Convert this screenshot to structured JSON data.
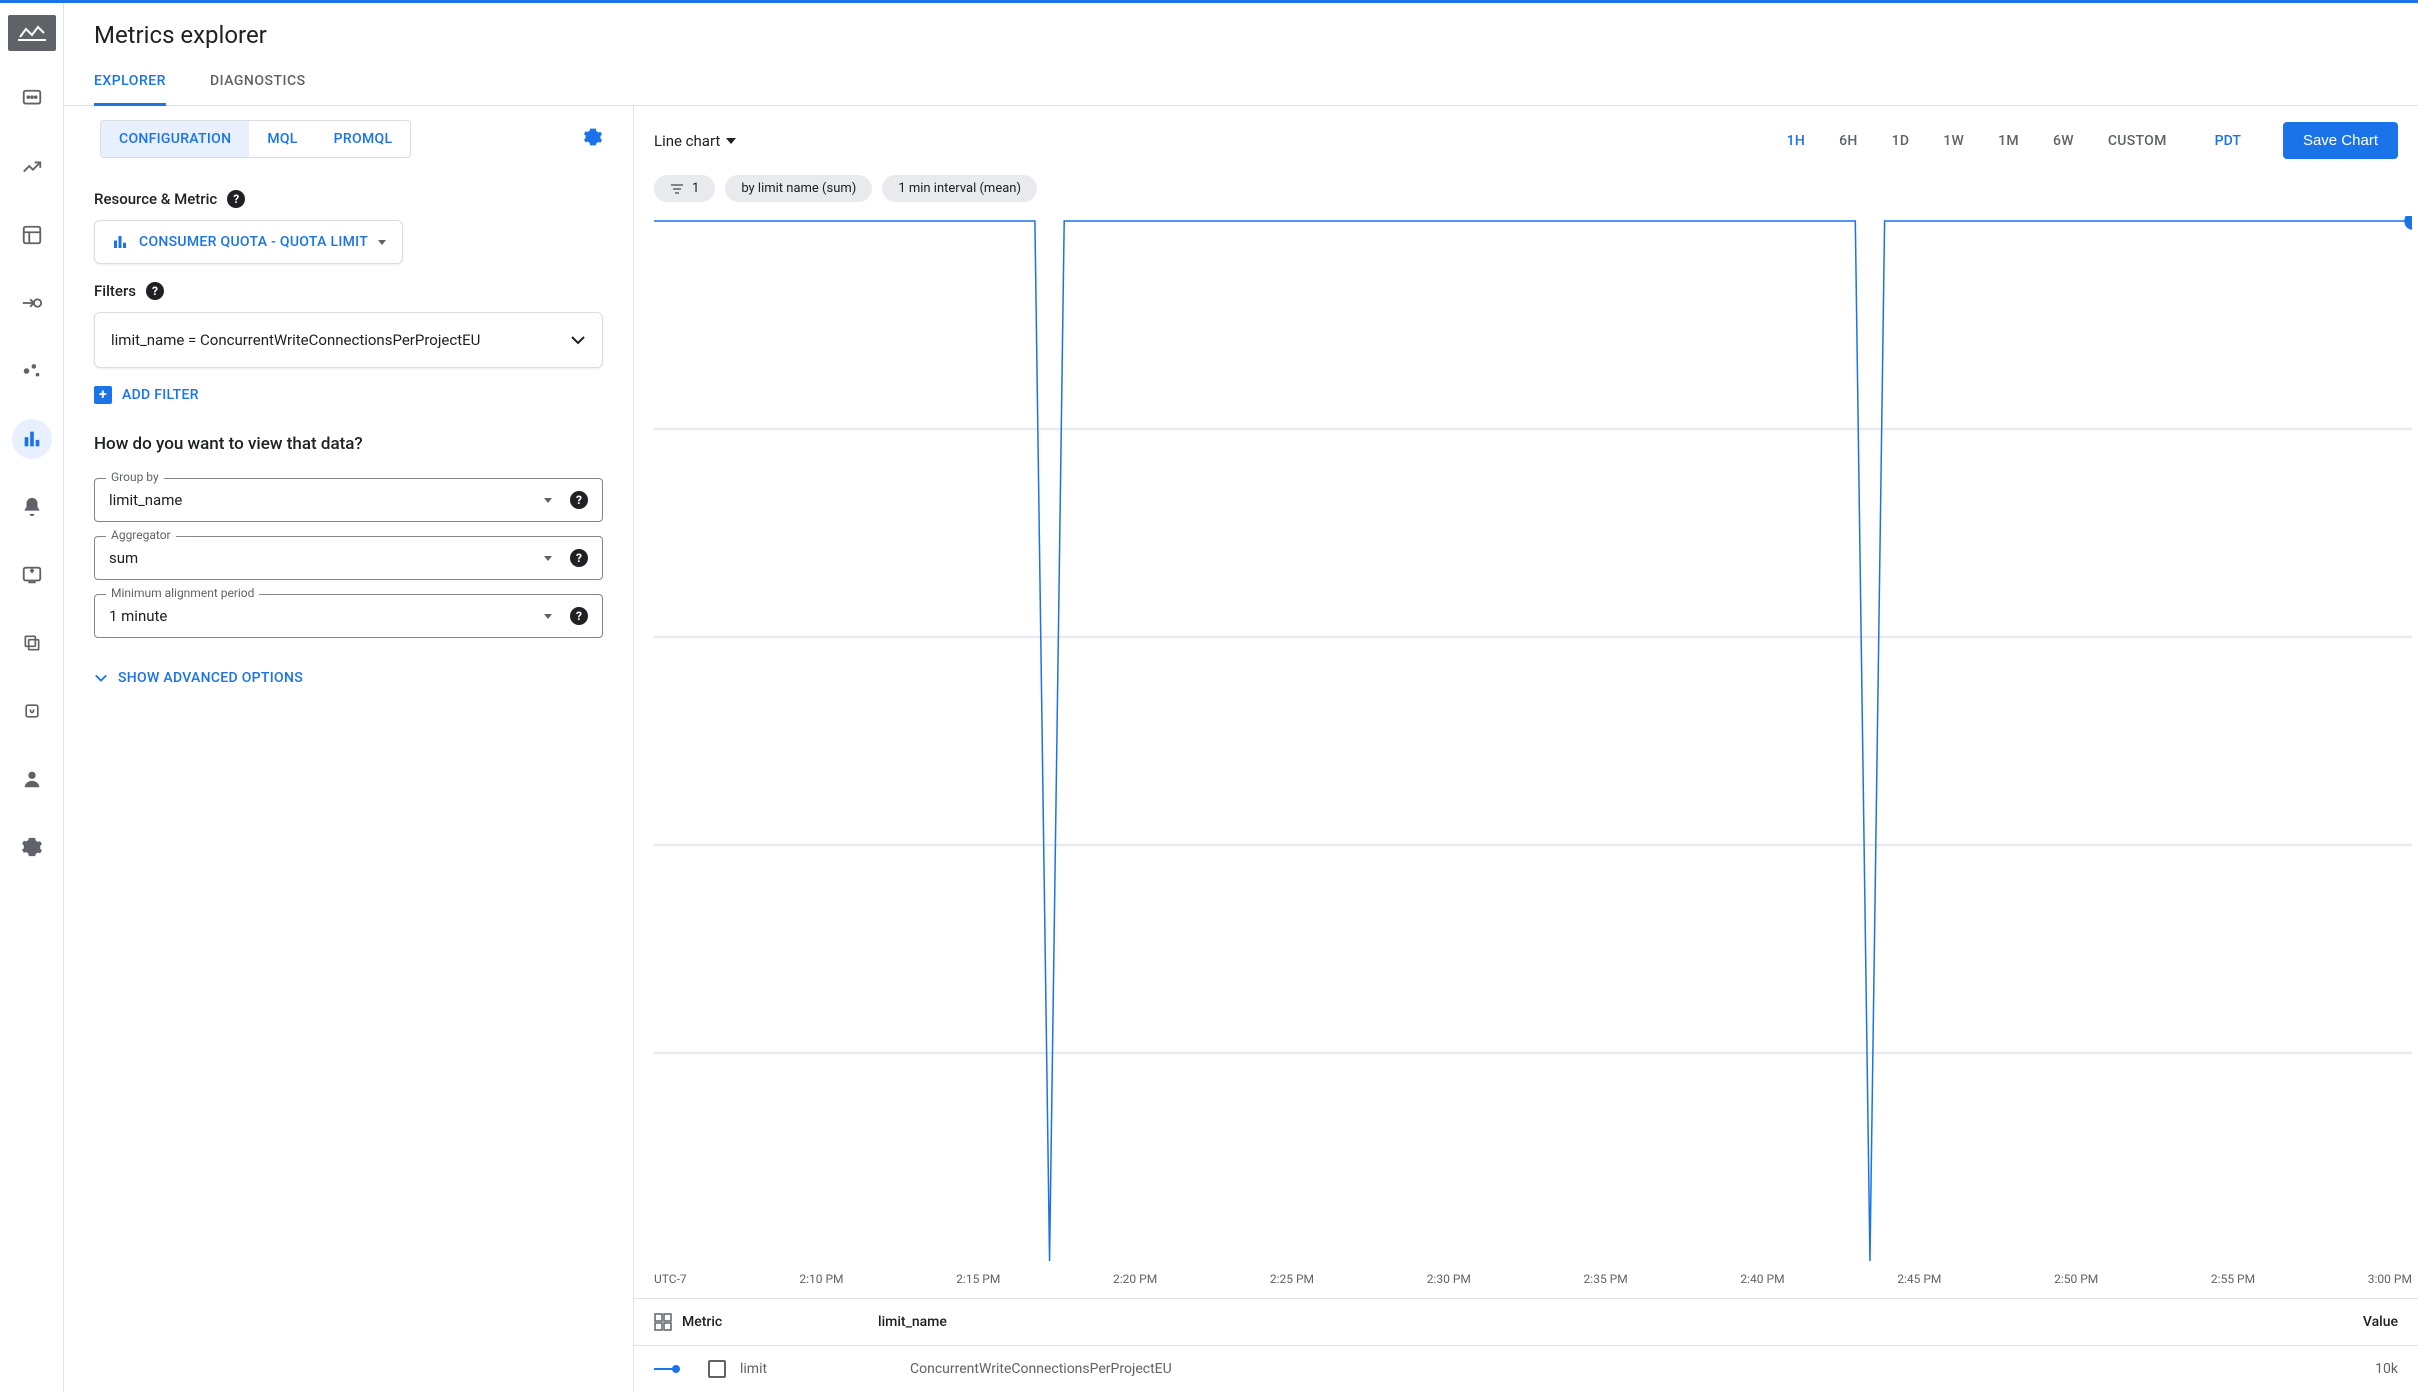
{
  "header": {
    "title": "Metrics explorer"
  },
  "tabs": {
    "explorer": "EXPLORER",
    "diagnostics": "DIAGNOSTICS"
  },
  "lang": {
    "config": "CONFIGURATION",
    "mql": "MQL",
    "promql": "PROMQL"
  },
  "resource": {
    "label": "Resource & Metric",
    "pill": "CONSUMER QUOTA - QUOTA LIMIT"
  },
  "filters": {
    "label": "Filters",
    "current": "limit_name = ConcurrentWriteConnectionsPerProjectEU",
    "add": "ADD FILTER"
  },
  "view": {
    "heading": "How do you want to view that data?",
    "groupby_label": "Group by",
    "groupby_value": "limit_name",
    "agg_label": "Aggregator",
    "agg_value": "sum",
    "align_label": "Minimum alignment period",
    "align_value": "1 minute",
    "advanced": "SHOW ADVANCED OPTIONS"
  },
  "chart": {
    "type": "Line chart",
    "ranges": [
      "1H",
      "6H",
      "1D",
      "1W",
      "1M",
      "6W",
      "CUSTOM"
    ],
    "active_range": "1H",
    "tz": "PDT",
    "save": "Save Chart",
    "chip_count": "1",
    "chip_group": "by limit name (sum)",
    "chip_interval": "1 min interval (mean)"
  },
  "chart_data": {
    "type": "line",
    "title": "",
    "xlabel": "UTC-7",
    "ylabel": "",
    "x_ticks": [
      "UTC-7",
      "2:10 PM",
      "2:15 PM",
      "2:20 PM",
      "2:25 PM",
      "2:30 PM",
      "2:35 PM",
      "2:40 PM",
      "2:45 PM",
      "2:50 PM",
      "2:55 PM",
      "3:00 PM"
    ],
    "series": [
      {
        "name": "limit",
        "limit_name": "ConcurrentWriteConnectionsPerProjectEU",
        "value_display": "10k",
        "color": "#1a73e8",
        "points": [
          [
            0,
            10000
          ],
          [
            13,
            10000
          ],
          [
            13.5,
            0
          ],
          [
            14,
            10000
          ],
          [
            41,
            10000
          ],
          [
            41.5,
            0
          ],
          [
            42,
            10000
          ],
          [
            60,
            10000
          ]
        ],
        "y_range": [
          0,
          10000
        ]
      }
    ]
  },
  "legend": {
    "col_metric": "Metric",
    "col_limit": "limit_name",
    "col_value": "Value"
  }
}
